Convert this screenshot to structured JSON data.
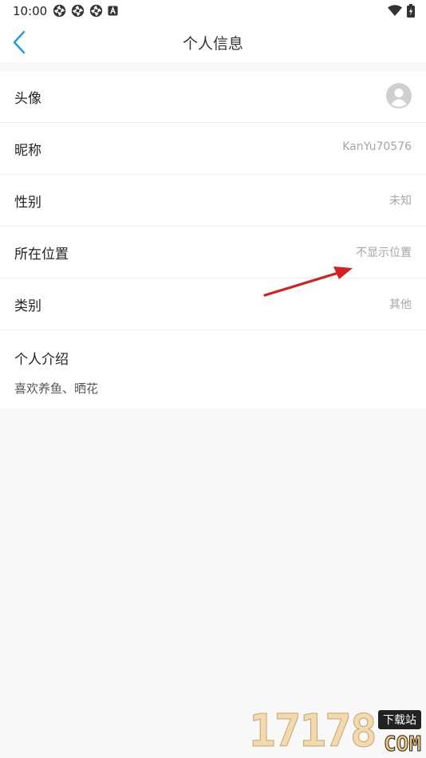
{
  "status_bar": {
    "time": "10:00",
    "left_icons": [
      "aperture-icon",
      "aperture-icon",
      "aperture-icon",
      "a-badge-icon"
    ],
    "right_icons": [
      "wifi-icon",
      "battery-icon"
    ]
  },
  "nav": {
    "back_icon": "chevron-left-icon",
    "title": "个人信息",
    "accent_color": "#1a9ee6"
  },
  "rows": [
    {
      "label": "头像",
      "value": ""
    },
    {
      "label": "昵称",
      "value": "KanYu70576"
    },
    {
      "label": "性别",
      "value": "未知"
    },
    {
      "label": "所在位置",
      "value": "不显示位置"
    },
    {
      "label": "类别",
      "value": "其他"
    }
  ],
  "intro": {
    "label": "个人介绍",
    "text": "喜欢养鱼、晒花"
  },
  "watermark": {
    "number": "17178",
    "tag": "下载站",
    "suffix": "COM"
  }
}
